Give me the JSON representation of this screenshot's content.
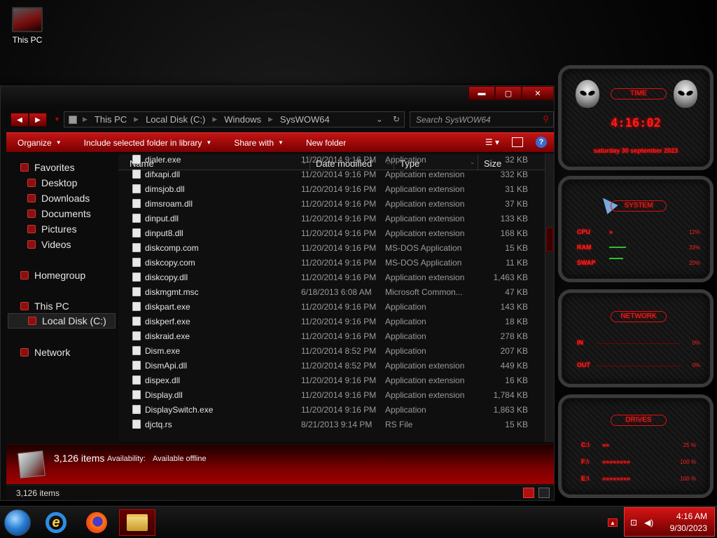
{
  "desktop": {
    "icon_label": "This PC"
  },
  "explorer": {
    "breadcrumb": [
      "This PC",
      "Local Disk (C:)",
      "Windows",
      "SysWOW64"
    ],
    "search_placeholder": "Search SysWOW64",
    "commands": {
      "organize": "Organize",
      "include": "Include selected folder in library",
      "share": "Share with",
      "new_folder": "New folder"
    },
    "nav": {
      "favorites": "Favorites",
      "desktop": "Desktop",
      "downloads": "Downloads",
      "documents": "Documents",
      "pictures": "Pictures",
      "videos": "Videos",
      "homegroup": "Homegroup",
      "this_pc": "This PC",
      "local_disk": "Local Disk (C:)",
      "network": "Network"
    },
    "columns": {
      "name": "Name",
      "date": "Date modified",
      "type": "Type",
      "size": "Size"
    },
    "files": [
      {
        "name": "dialer.exe",
        "date": "11/20/2014 9:16 PM",
        "type": "Application",
        "size": "32 KB"
      },
      {
        "name": "difxapi.dll",
        "date": "11/20/2014 9:16 PM",
        "type": "Application extension",
        "size": "332 KB"
      },
      {
        "name": "dimsjob.dll",
        "date": "11/20/2014 9:16 PM",
        "type": "Application extension",
        "size": "31 KB"
      },
      {
        "name": "dimsroam.dll",
        "date": "11/20/2014 9:16 PM",
        "type": "Application extension",
        "size": "37 KB"
      },
      {
        "name": "dinput.dll",
        "date": "11/20/2014 9:16 PM",
        "type": "Application extension",
        "size": "133 KB"
      },
      {
        "name": "dinput8.dll",
        "date": "11/20/2014 9:16 PM",
        "type": "Application extension",
        "size": "168 KB"
      },
      {
        "name": "diskcomp.com",
        "date": "11/20/2014 9:16 PM",
        "type": "MS-DOS Application",
        "size": "15 KB"
      },
      {
        "name": "diskcopy.com",
        "date": "11/20/2014 9:16 PM",
        "type": "MS-DOS Application",
        "size": "11 KB"
      },
      {
        "name": "diskcopy.dll",
        "date": "11/20/2014 9:16 PM",
        "type": "Application extension",
        "size": "1,463 KB"
      },
      {
        "name": "diskmgmt.msc",
        "date": "6/18/2013 6:08 AM",
        "type": "Microsoft Common...",
        "size": "47 KB"
      },
      {
        "name": "diskpart.exe",
        "date": "11/20/2014 9:16 PM",
        "type": "Application",
        "size": "143 KB"
      },
      {
        "name": "diskperf.exe",
        "date": "11/20/2014 9:16 PM",
        "type": "Application",
        "size": "18 KB"
      },
      {
        "name": "diskraid.exe",
        "date": "11/20/2014 9:16 PM",
        "type": "Application",
        "size": "278 KB"
      },
      {
        "name": "Dism.exe",
        "date": "11/20/2014 8:52 PM",
        "type": "Application",
        "size": "207 KB"
      },
      {
        "name": "DismApi.dll",
        "date": "11/20/2014 8:52 PM",
        "type": "Application extension",
        "size": "449 KB"
      },
      {
        "name": "dispex.dll",
        "date": "11/20/2014 9:16 PM",
        "type": "Application extension",
        "size": "16 KB"
      },
      {
        "name": "Display.dll",
        "date": "11/20/2014 9:16 PM",
        "type": "Application extension",
        "size": "1,784 KB"
      },
      {
        "name": "DisplaySwitch.exe",
        "date": "11/20/2014 9:16 PM",
        "type": "Application",
        "size": "1,863 KB"
      },
      {
        "name": "djctq.rs",
        "date": "8/21/2013 9:14 PM",
        "type": "RS File",
        "size": "15 KB"
      }
    ],
    "details": {
      "count": "3,126 items",
      "avail_label": "Availability:",
      "avail_value": "Available offline"
    },
    "status": "3,126 items"
  },
  "gadgets": {
    "time_title": "TIME",
    "time": "4:16:02",
    "date": "saturday 30 september 2023",
    "system_title": "SYSTEM",
    "cpu_label": "CPU",
    "cpu": "12%",
    "ram_label": "RAM",
    "ram": "33%",
    "swap_label": "SWAP",
    "swap": "20%",
    "network_title": "NETWORK",
    "in_label": "IN",
    "in": "0%",
    "out_label": "OUT",
    "out": "0%",
    "drives_title": "DRIVES",
    "drives": [
      {
        "label": "C:\\",
        "value": "25 %"
      },
      {
        "label": "F:\\",
        "value": "100 %"
      },
      {
        "label": "E:\\",
        "value": "100 %"
      }
    ]
  },
  "taskbar": {
    "time": "4:16 AM",
    "date": "9/30/2023"
  }
}
